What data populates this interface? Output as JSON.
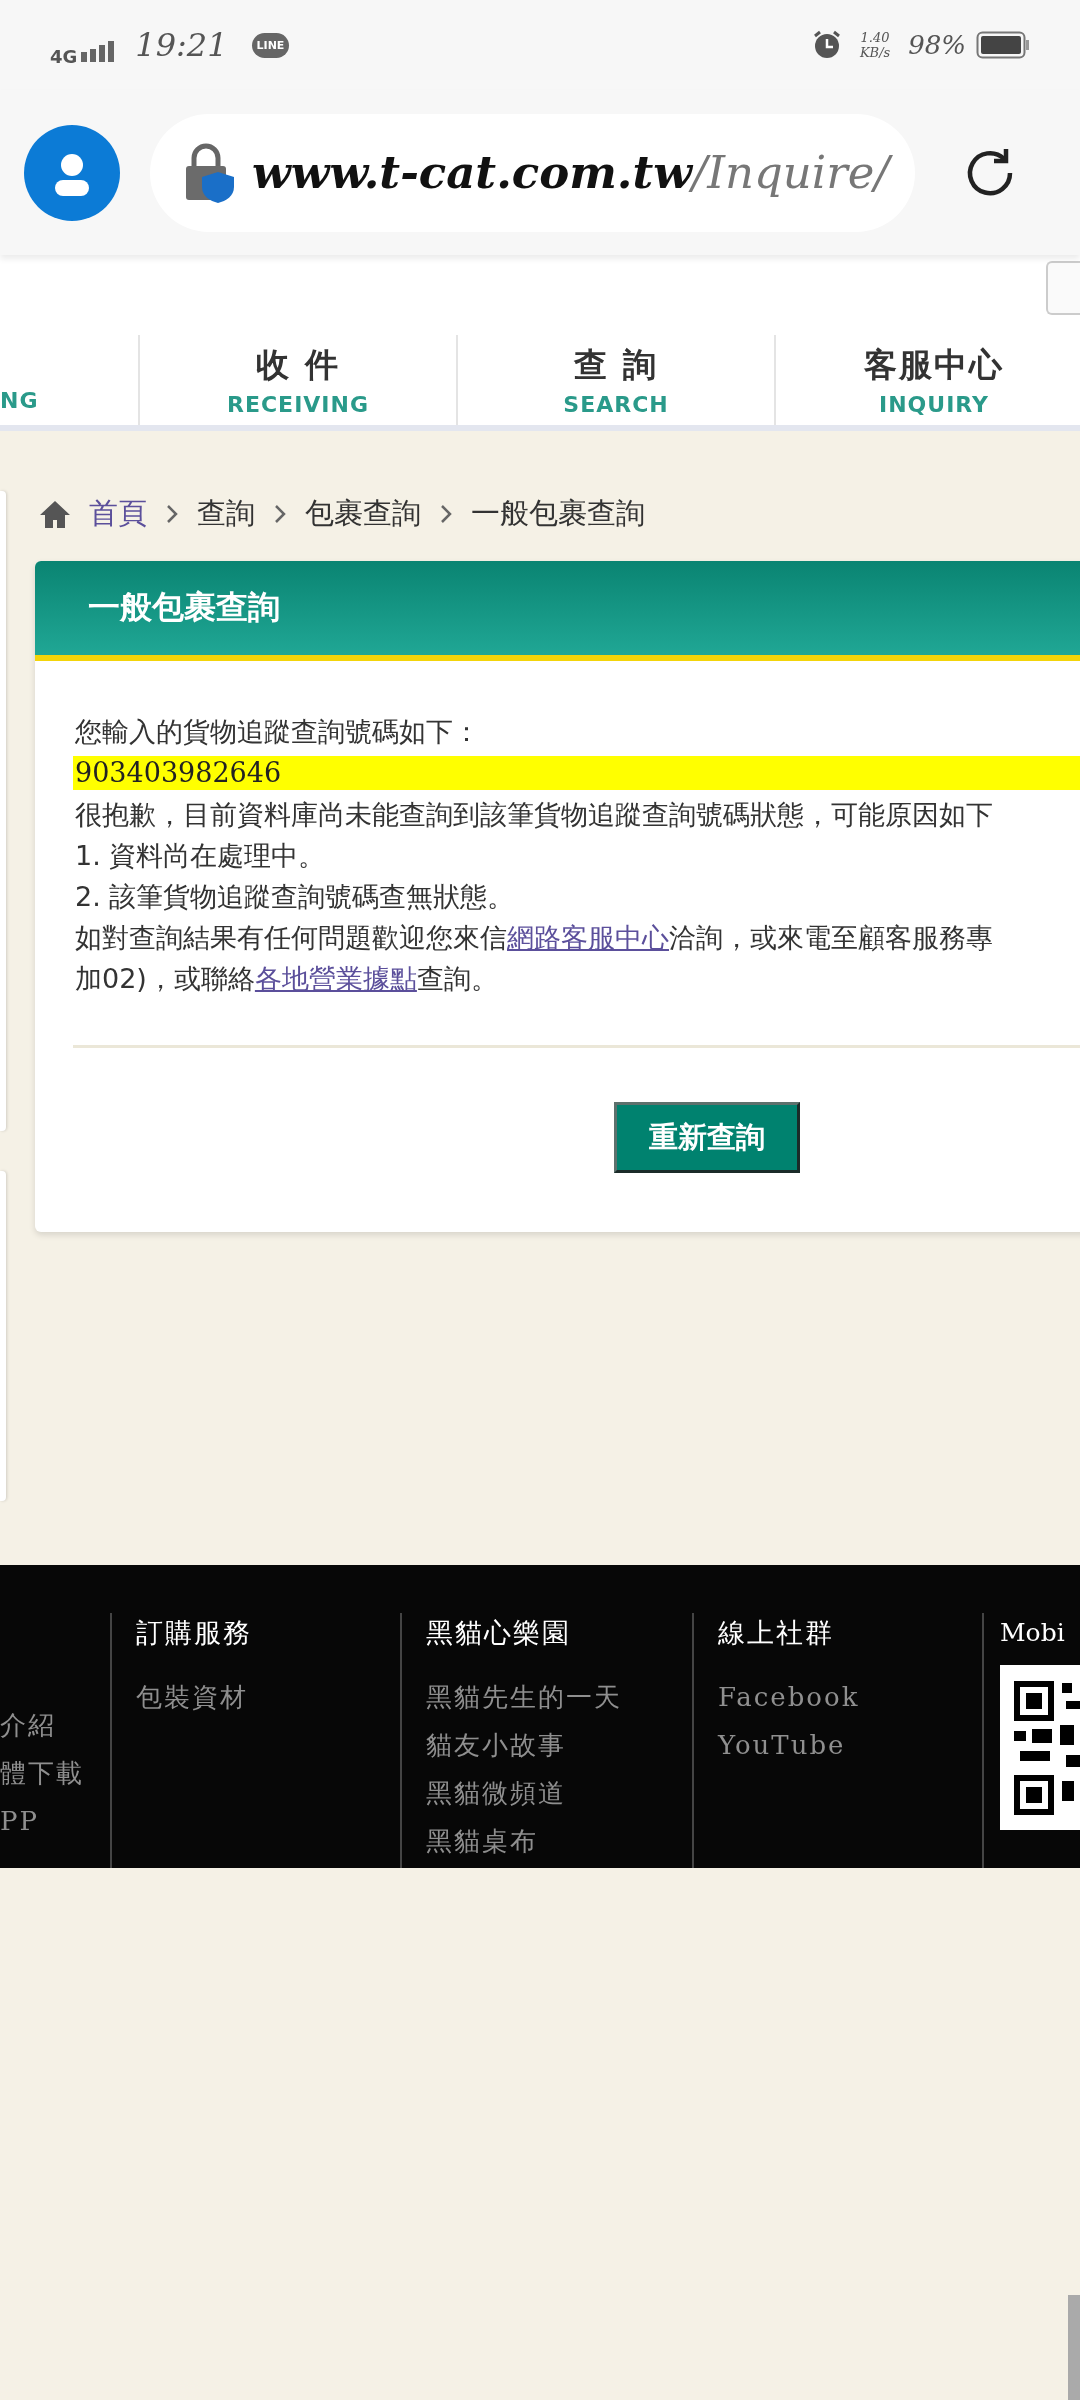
{
  "status_bar": {
    "network": "4G",
    "time": "19:21",
    "app_badge": "LINE",
    "speed_value": "1.40",
    "speed_unit": "KB/s",
    "battery": "98%"
  },
  "browser": {
    "url_host": "www.t-cat.com.tw",
    "url_path": "/Inquire/"
  },
  "nav_tabs": [
    {
      "subtitle": "NG"
    },
    {
      "title": "收 件",
      "subtitle": "RECEIVING"
    },
    {
      "title": "查 詢",
      "subtitle": "SEARCH"
    },
    {
      "title": "客服中心",
      "subtitle": "INQUIRY"
    }
  ],
  "breadcrumb": [
    {
      "label": "首頁",
      "kind": "link"
    },
    {
      "label": "查詢",
      "kind": "text"
    },
    {
      "label": "包裹查詢",
      "kind": "text"
    },
    {
      "label": "一般包裹查詢",
      "kind": "text"
    }
  ],
  "panel": {
    "title": "一般包裹查詢",
    "intro": "您輸入的貨物追蹤查詢號碼如下：",
    "tracking_number": "903403982646",
    "message": "很抱歉，目前資料庫尚未能查詢到該筆貨物追蹤查詢號碼狀態，可能原因如下",
    "reasons": [
      "1. 資料尚在處理中。",
      "2. 該筆貨物追蹤查詢號碼查無狀態。"
    ],
    "contact_lines": [
      [
        {
          "kind": "text",
          "text": "如對查詢結果有任何問題歡迎您來信"
        },
        {
          "kind": "link",
          "text": "網路客服中心"
        },
        {
          "kind": "text",
          "text": "洽詢，或來電至顧客服務專"
        }
      ],
      [
        {
          "kind": "text",
          "text": "加02)，或聯絡"
        },
        {
          "kind": "link",
          "text": "各地營業據點"
        },
        {
          "kind": "text",
          "text": "查詢。"
        }
      ]
    ],
    "button": "重新查詢"
  },
  "footer": {
    "columns": [
      {
        "items": [
          "介紹",
          "體下載",
          "PP"
        ]
      },
      {
        "heading": "訂購服務",
        "items": [
          "包裝資材"
        ]
      },
      {
        "heading": "黑貓心樂園",
        "items": [
          "黑貓先生的一天",
          "貓友小故事",
          "黑貓微頻道",
          "黑貓桌布"
        ]
      },
      {
        "heading": "線上社群",
        "items": [
          "Facebook",
          "YouTube"
        ]
      },
      {
        "heading": "Mobi",
        "kind": "qr"
      }
    ]
  }
}
